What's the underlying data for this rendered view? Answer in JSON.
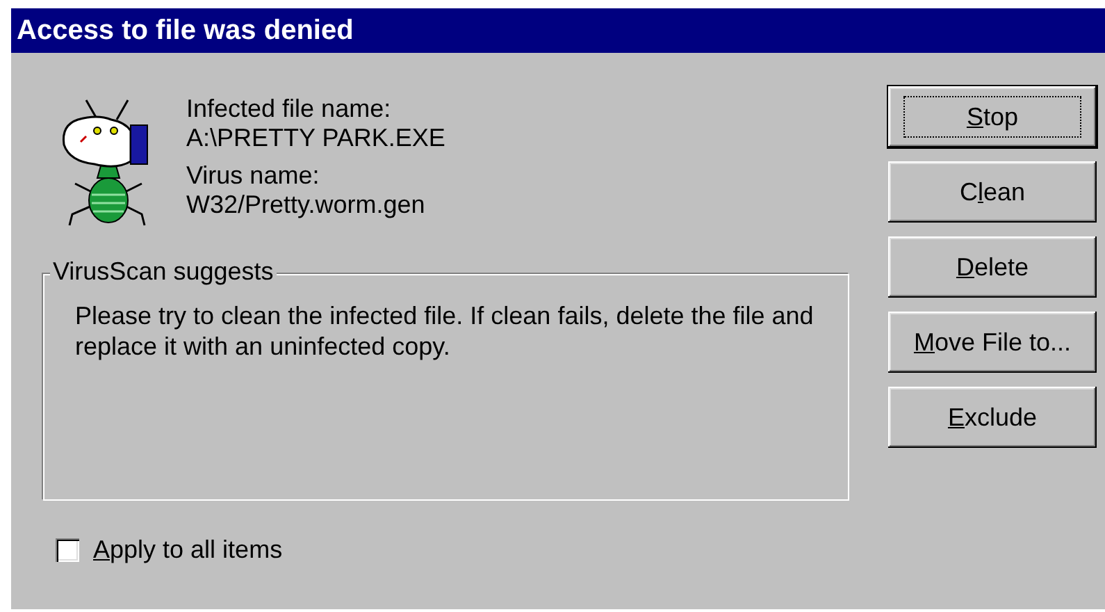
{
  "window": {
    "title": "Access to file was denied"
  },
  "info": [
    {
      "label": "Infected file name:",
      "value": "A:\\PRETTY PARK.EXE"
    },
    {
      "label": "Virus name:",
      "value": "W32/Pretty.worm.gen"
    }
  ],
  "suggestion": {
    "legend": "VirusScan suggests",
    "text": "Please try to clean the infected file. If clean fails, delete the file and replace it with an uninfected copy."
  },
  "buttons": [
    {
      "key": "S",
      "post": "top",
      "default": true
    },
    {
      "pre": "C",
      "key": "l",
      "post": "ean",
      "default": false
    },
    {
      "key": "D",
      "post": "elete",
      "default": false
    },
    {
      "key": "M",
      "post": "ove File to...",
      "default": false
    },
    {
      "key": "E",
      "post": "xclude",
      "default": false
    }
  ],
  "apply_all": {
    "key": "A",
    "post": "pply to all items",
    "checked": false
  }
}
